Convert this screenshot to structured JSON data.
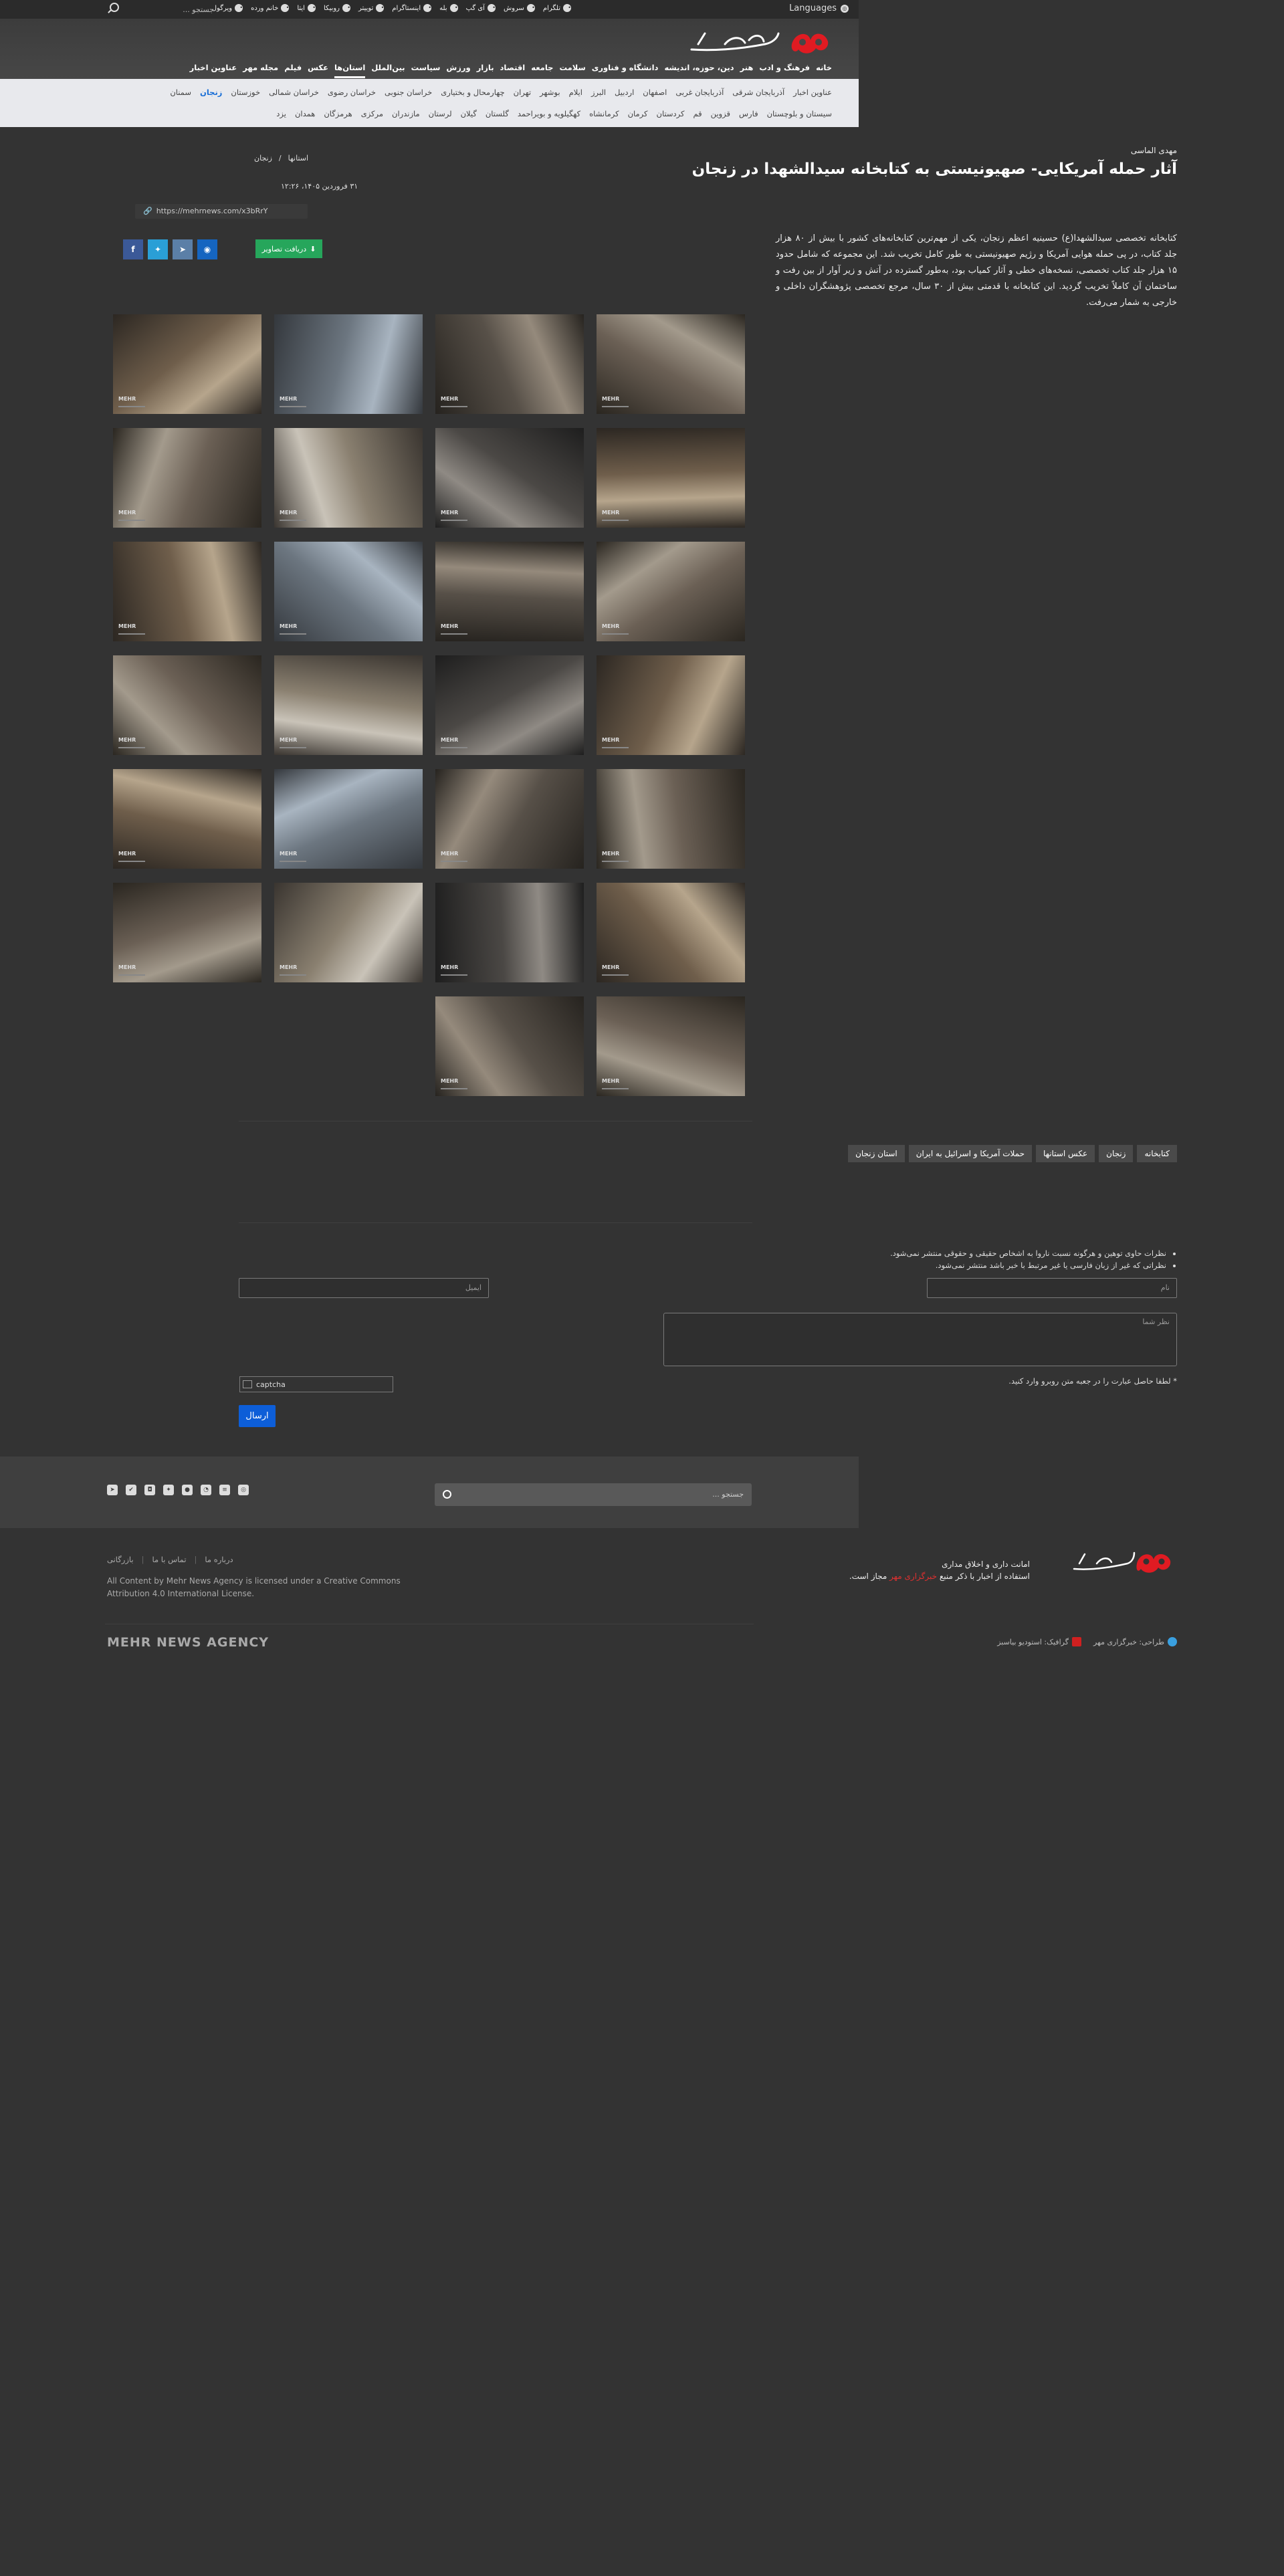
{
  "topbar": {
    "languages_label": "Languages",
    "search_placeholder": "جستجو ...",
    "social": [
      "تلگرام",
      "سروش",
      "آی گپ",
      "بله",
      "اینستاگرام",
      "توییتر",
      "روبیکا",
      "ایتا",
      "خانم ورده",
      "ویرگول"
    ]
  },
  "nav": {
    "items": [
      "خانه",
      "فرهنگ و ادب",
      "هنر",
      "دین، حوزه، اندیشه",
      "دانشگاه و فناوری",
      "سلامت",
      "جامعه",
      "اقتصاد",
      "بازار",
      "ورزش",
      "سیاست",
      "بین‌الملل",
      "استان‌ها",
      "عکس",
      "فیلم",
      "مجله مهر",
      "عناوین اخبار"
    ],
    "active_index": 12
  },
  "provinces": {
    "row1": [
      "عناوین اخبار",
      "آذربایجان شرقی",
      "آذربایجان غربی",
      "اصفهان",
      "اردبیل",
      "البرز",
      "ایلام",
      "بوشهر",
      "تهران",
      "چهارمحال و بختیاری",
      "خراسان جنوبی",
      "خراسان رضوی",
      "خراسان شمالی",
      "خوزستان",
      "زنجان",
      "سمنان"
    ],
    "row1_active_index": 14,
    "row2": [
      "سیستان و بلوچستان",
      "فارس",
      "قزوین",
      "قم",
      "کردستان",
      "کرمان",
      "کرمانشاه",
      "کهگیلویه و بویراحمد",
      "گلستان",
      "گیلان",
      "لرستان",
      "مازندران",
      "مرکزی",
      "هرمزگان",
      "همدان",
      "یزد"
    ]
  },
  "article": {
    "author": "مهدی الماسی",
    "title": "آثار حمله آمریکایی- صهیونیستی به کتابخانه سیدالشهدا در زنجان",
    "breadcrumb": [
      "استانها",
      "زنجان"
    ],
    "breadcrumb_sep": "/",
    "date": "۳۱ فروردین ۱۴۰۵، ۱۲:۲۶",
    "short_url": "https://mehrnews.com/x3bRrY",
    "download_label": "دریافت تصاویر",
    "lead": "کتابخانه تخصصی سیدالشهدا(ع) حسینیه اعظم زنجان، یکی از مهم‌ترین کتابخانه‌های کشور با بیش از ۸۰ هزار جلد کتاب، در پی حمله هوایی آمریکا و رژیم صهیونیستی به طور کامل تخریب شد. این مجموعه که شامل حدود ۱۵ هزار جلد کتاب تخصصی، نسخه‌های خطی و آثار کمیاب بود، به‌طور گسترده در آتش و زیر آوار از بین رفت و ساختمان آن کاملاً تخریب گردید. این کتابخانه با قدمتی بیش از ۳۰ سال، مرجع تخصصی پژوهشگران داخلی و خارجی به شمار می‌رفت."
  },
  "gallery": {
    "watermark": "MEHR",
    "count": 26
  },
  "tags": [
    "کتابخانه",
    "زنجان",
    "عکس استانها",
    "حملات آمریکا و اسرائیل به ایران",
    "استان زنجان"
  ],
  "comments": {
    "rules": [
      "نظرات حاوی توهین و هرگونه نسبت ناروا به اشخاص حقیقی و حقوقی منتشر نمی‌شود.",
      "نظراتی که غیر از زبان فارسی یا غیر مرتبط با خبر باشد منتشر نمی‌شود."
    ],
    "name_placeholder": "نام",
    "email_placeholder": "ایمیل",
    "comment_placeholder": "نظر شما",
    "captcha_note": "* لطفا حاصل عبارت را در جعبه متن روبرو وارد کنید.",
    "captcha_label": "captcha",
    "send_label": "ارسال"
  },
  "footer": {
    "search_placeholder": "جستجو ...",
    "notice_line1": "امانت داری و اخلاق مداری",
    "notice_line2_a": "استفاده از اخبار با ذکر منبع ",
    "notice_line2_red": "خبرگزاری مهر",
    "notice_line2_b": " مجاز است.",
    "links": [
      "درباره ما",
      "تماس با ما",
      "بازرگانی"
    ],
    "license": "All Content by Mehr News Agency is licensed under a Creative Commons Attribution 4.0 International License.",
    "brand": "MEHR NEWS AGENCY",
    "partner_links": [
      "طراحی: خبرگزاری مهر",
      "گرافیک: استودیو بیاسبز"
    ]
  }
}
